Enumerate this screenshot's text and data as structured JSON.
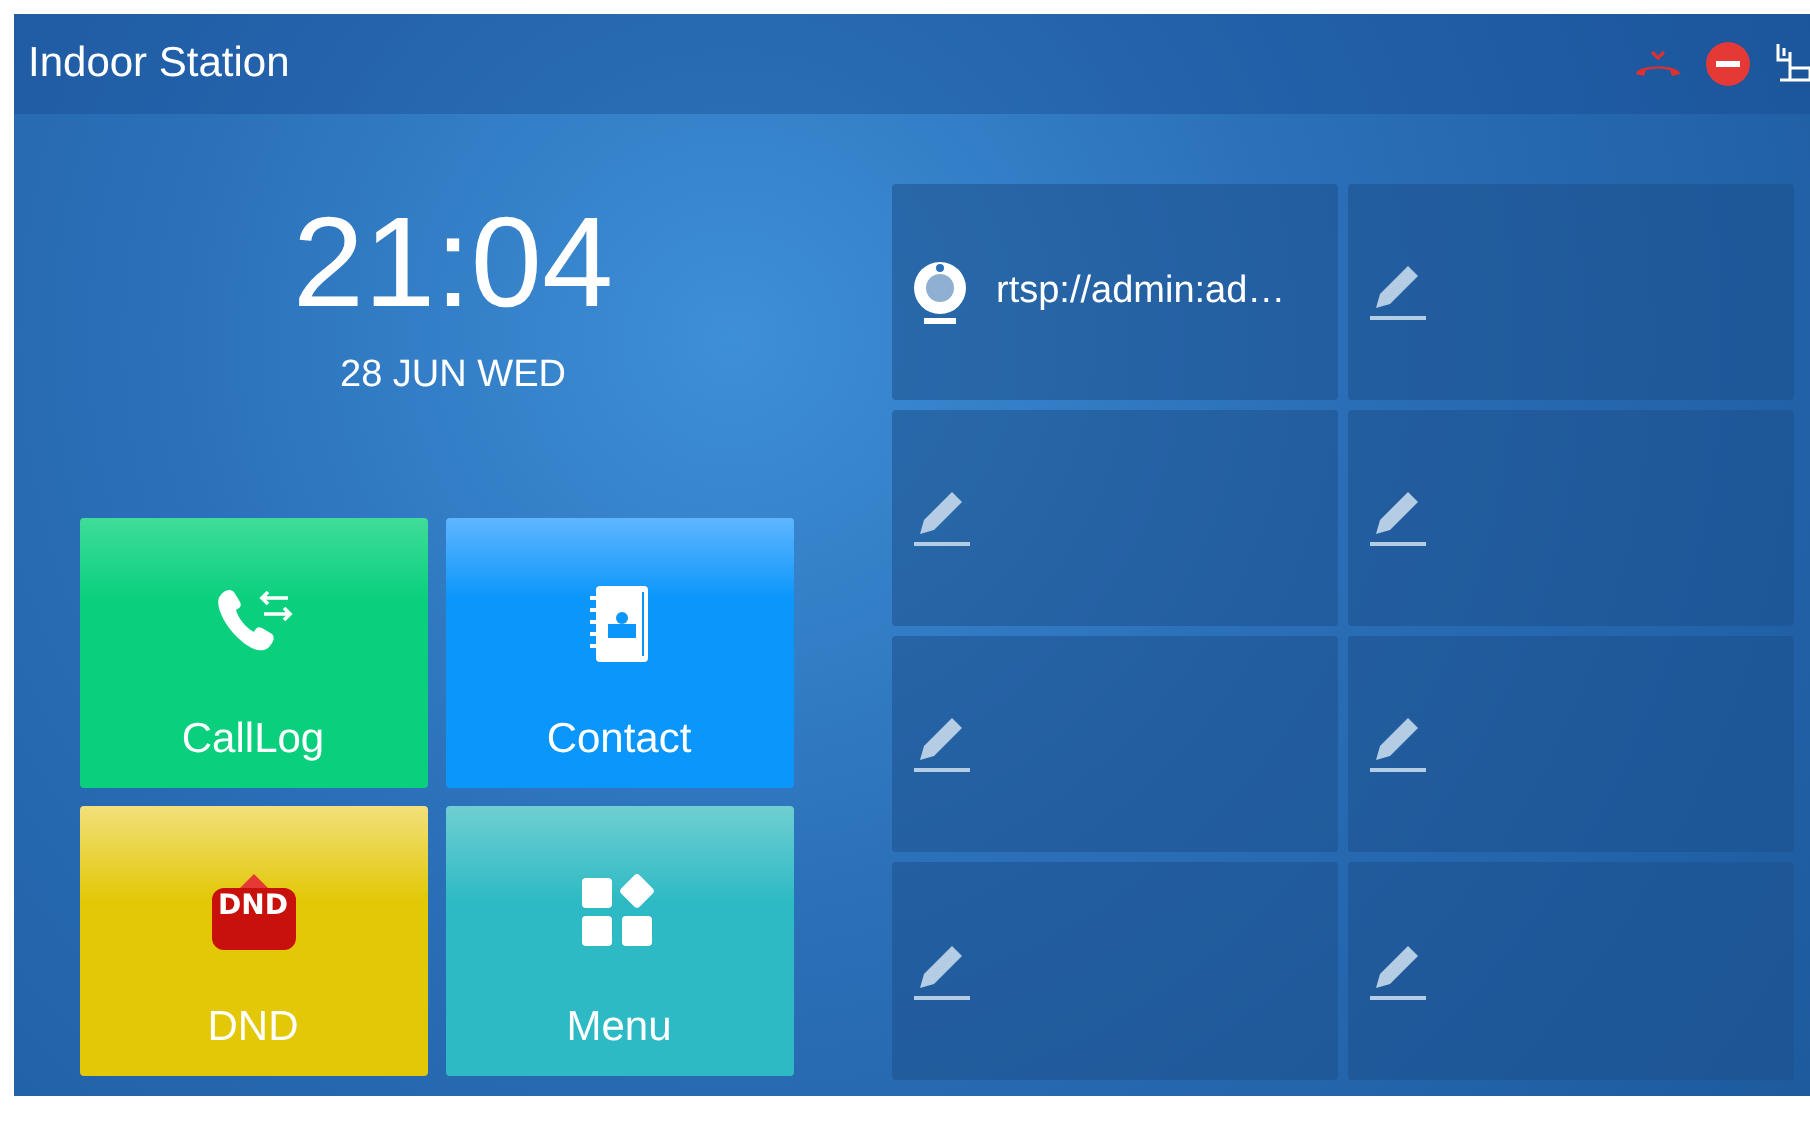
{
  "title_bar": {
    "title": "Indoor Station",
    "status_icons": [
      {
        "kind": "missed-call"
      },
      {
        "kind": "dnd"
      },
      {
        "kind": "network"
      }
    ]
  },
  "clock": {
    "time": "21:04",
    "date": "28 JUN WED"
  },
  "tiles": [
    {
      "kind": "calllog",
      "label": "CallLog"
    },
    {
      "kind": "contact",
      "label": "Contact"
    },
    {
      "kind": "dnd",
      "label": "DND",
      "badge": "DND"
    },
    {
      "kind": "menu",
      "label": "Menu"
    }
  ],
  "monitors": [
    {
      "kind": "camera",
      "label": "rtsp://admin:ad…"
    },
    {
      "kind": "empty"
    },
    {
      "kind": "empty"
    },
    {
      "kind": "empty"
    },
    {
      "kind": "empty"
    },
    {
      "kind": "empty"
    },
    {
      "kind": "empty"
    },
    {
      "kind": "empty"
    }
  ]
}
